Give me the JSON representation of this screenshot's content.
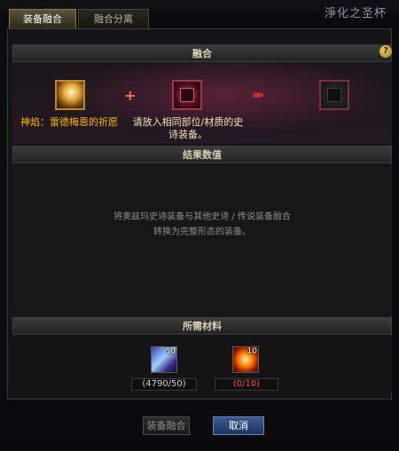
{
  "window": {
    "background_title": "淨化之圣杯"
  },
  "tabs": [
    {
      "label": "装备融合",
      "active": true
    },
    {
      "label": "融合分离",
      "active": false
    }
  ],
  "fusion_section": {
    "title": "融合",
    "help_label": "?",
    "item_label": "神焰：雷德梅恩的祈愿",
    "material_label": "请放入相同部位/材质的史诗装备。",
    "plus_symbol": "+",
    "arrow_symbol": "»»"
  },
  "result_section": {
    "title": "结果数值",
    "description_line1": "将奥兹玛史诗装备与其他史诗 / 传说装备融合",
    "description_line2": "转换为完整形态的装备。"
  },
  "materials_section": {
    "title": "所需材料",
    "items": [
      {
        "icon": "crystal-material-icon",
        "count_badge": "50",
        "status": "(4790/50)",
        "status_color": "#cfcfcf"
      },
      {
        "icon": "fire-material-icon",
        "count_badge": "10",
        "status": "(0/10)",
        "status_color": "#ff4848"
      }
    ]
  },
  "buttons": {
    "fuse_label": "装备融合",
    "cancel_label": "取消"
  },
  "colors": {
    "accent_gold": "#ffb700",
    "error_red": "#ff4848",
    "cancel_blue": "#2a4a80"
  }
}
